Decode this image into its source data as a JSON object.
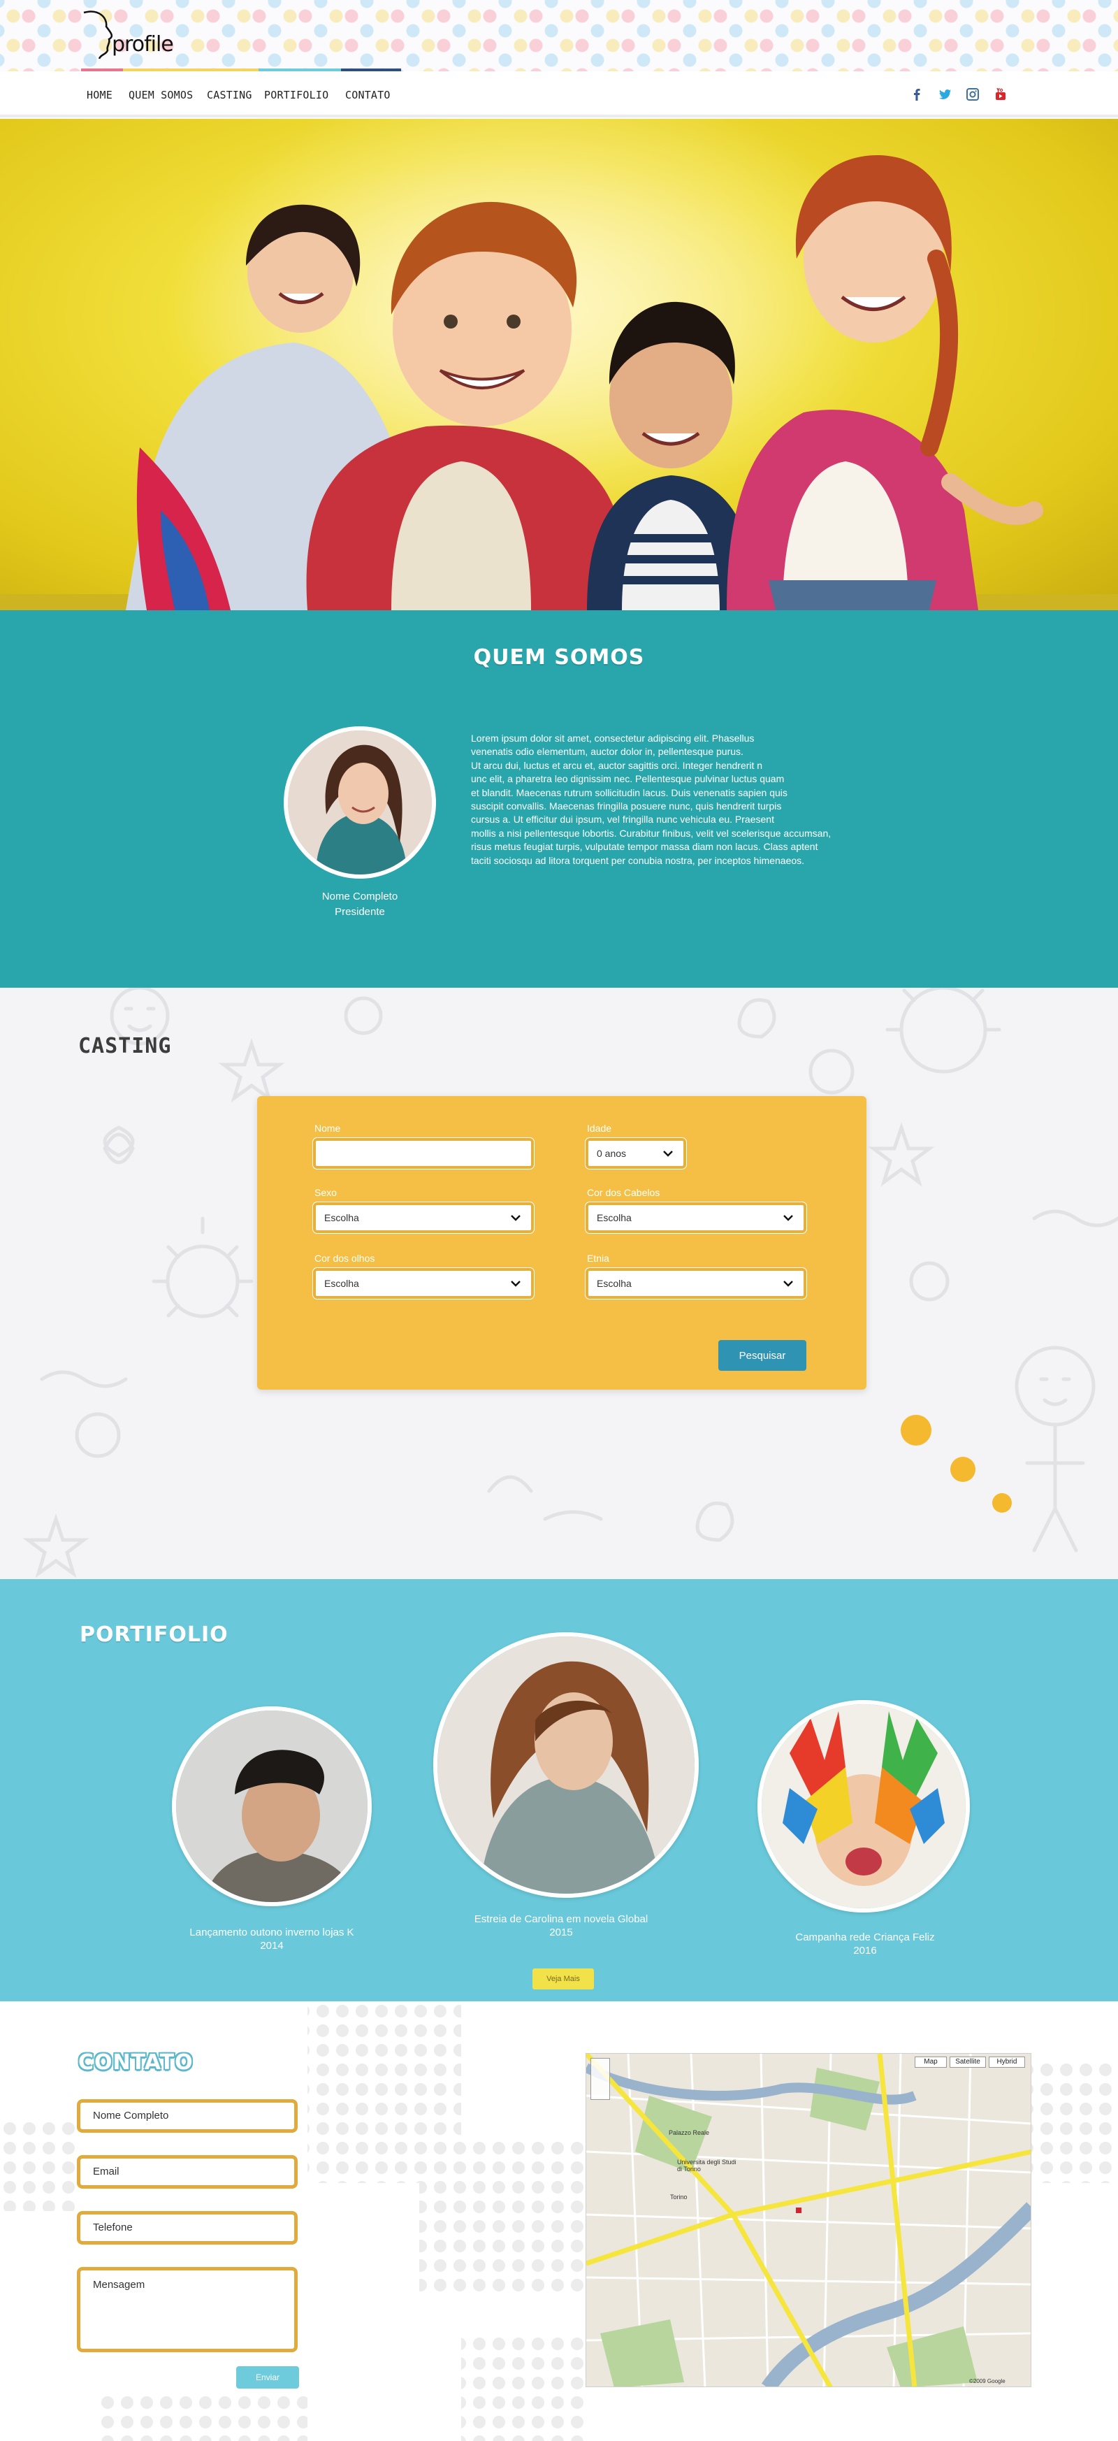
{
  "header": {
    "logo_text": "profile",
    "nav": [
      "HOME",
      "QUEM SOMOS",
      "CASTING",
      "PORTIFOLIO",
      "CONTATO"
    ],
    "social": [
      "facebook-icon",
      "twitter-icon",
      "instagram-icon",
      "youtube-icon"
    ],
    "colors": {
      "accent_pink": "#e8748d",
      "accent_yellow": "#f4d35e",
      "accent_teal": "#6ecbdb",
      "accent_navy": "#2c4f7c"
    }
  },
  "about": {
    "title": "QUEM SOMOS",
    "name": "Nome Completo",
    "role": "Presidente",
    "text_lines": [
      "Lorem ipsum dolor sit amet, consectetur adipiscing elit. Phasellus",
      "venenatis odio elementum, auctor dolor in, pellentesque purus.",
      "Ut arcu dui, luctus et arcu et, auctor sagittis orci. Integer hendrerit n",
      "unc elit, a pharetra leo dignissim nec. Pellentesque pulvinar luctus quam",
      "et blandit. Maecenas rutrum sollicitudin lacus. Duis venenatis sapien quis",
      " suscipit convallis. Maecenas fringilla posuere nunc, quis hendrerit turpis",
      "cursus a. Ut efficitur dui ipsum, vel fringilla nunc vehicula eu. Praesent",
      "mollis a nisi pellentesque lobortis. Curabitur finibus, velit vel scelerisque accumsan,",
      "risus metus feugiat turpis, vulputate tempor massa diam non lacus. Class aptent",
      "taciti sociosqu ad litora torquent per conubia nostra, per inceptos himenaeos."
    ]
  },
  "casting": {
    "title": "CASTING",
    "fields": {
      "nome": {
        "label": "Nome",
        "value": ""
      },
      "idade": {
        "label": "Idade",
        "value": "0 anos"
      },
      "sexo": {
        "label": "Sexo",
        "value": "Escolha"
      },
      "cabelos": {
        "label": "Cor dos Cabelos",
        "value": "Escolha"
      },
      "olhos": {
        "label": "Cor dos olhos",
        "value": "Escolha"
      },
      "etnia": {
        "label": "Etnia",
        "value": "Escolha"
      }
    },
    "search_label": "Pesquisar"
  },
  "portfolio": {
    "title": "PORTIFOLIO",
    "items": [
      {
        "caption": "Lançamento outono inverno lojas K",
        "year": "2014"
      },
      {
        "caption": "Estreia de Carolina em novela Global",
        "year": "2015"
      },
      {
        "caption": "Campanha rede Criança Feliz",
        "year": "2016"
      }
    ],
    "more_label": "Veja Mais"
  },
  "contact": {
    "title": "CONTATO",
    "fields": {
      "name": "Nome Completo",
      "email": "Email",
      "phone": "Telefone",
      "message": "Mensagem"
    },
    "send_label": "Enviar",
    "map": {
      "buttons": [
        "Map",
        "Satellite",
        "Hybrid"
      ],
      "labels": [
        "Torino",
        "Universita degli Studi di Torino",
        "Palazzo Reale",
        "©2009 Google"
      ]
    }
  }
}
